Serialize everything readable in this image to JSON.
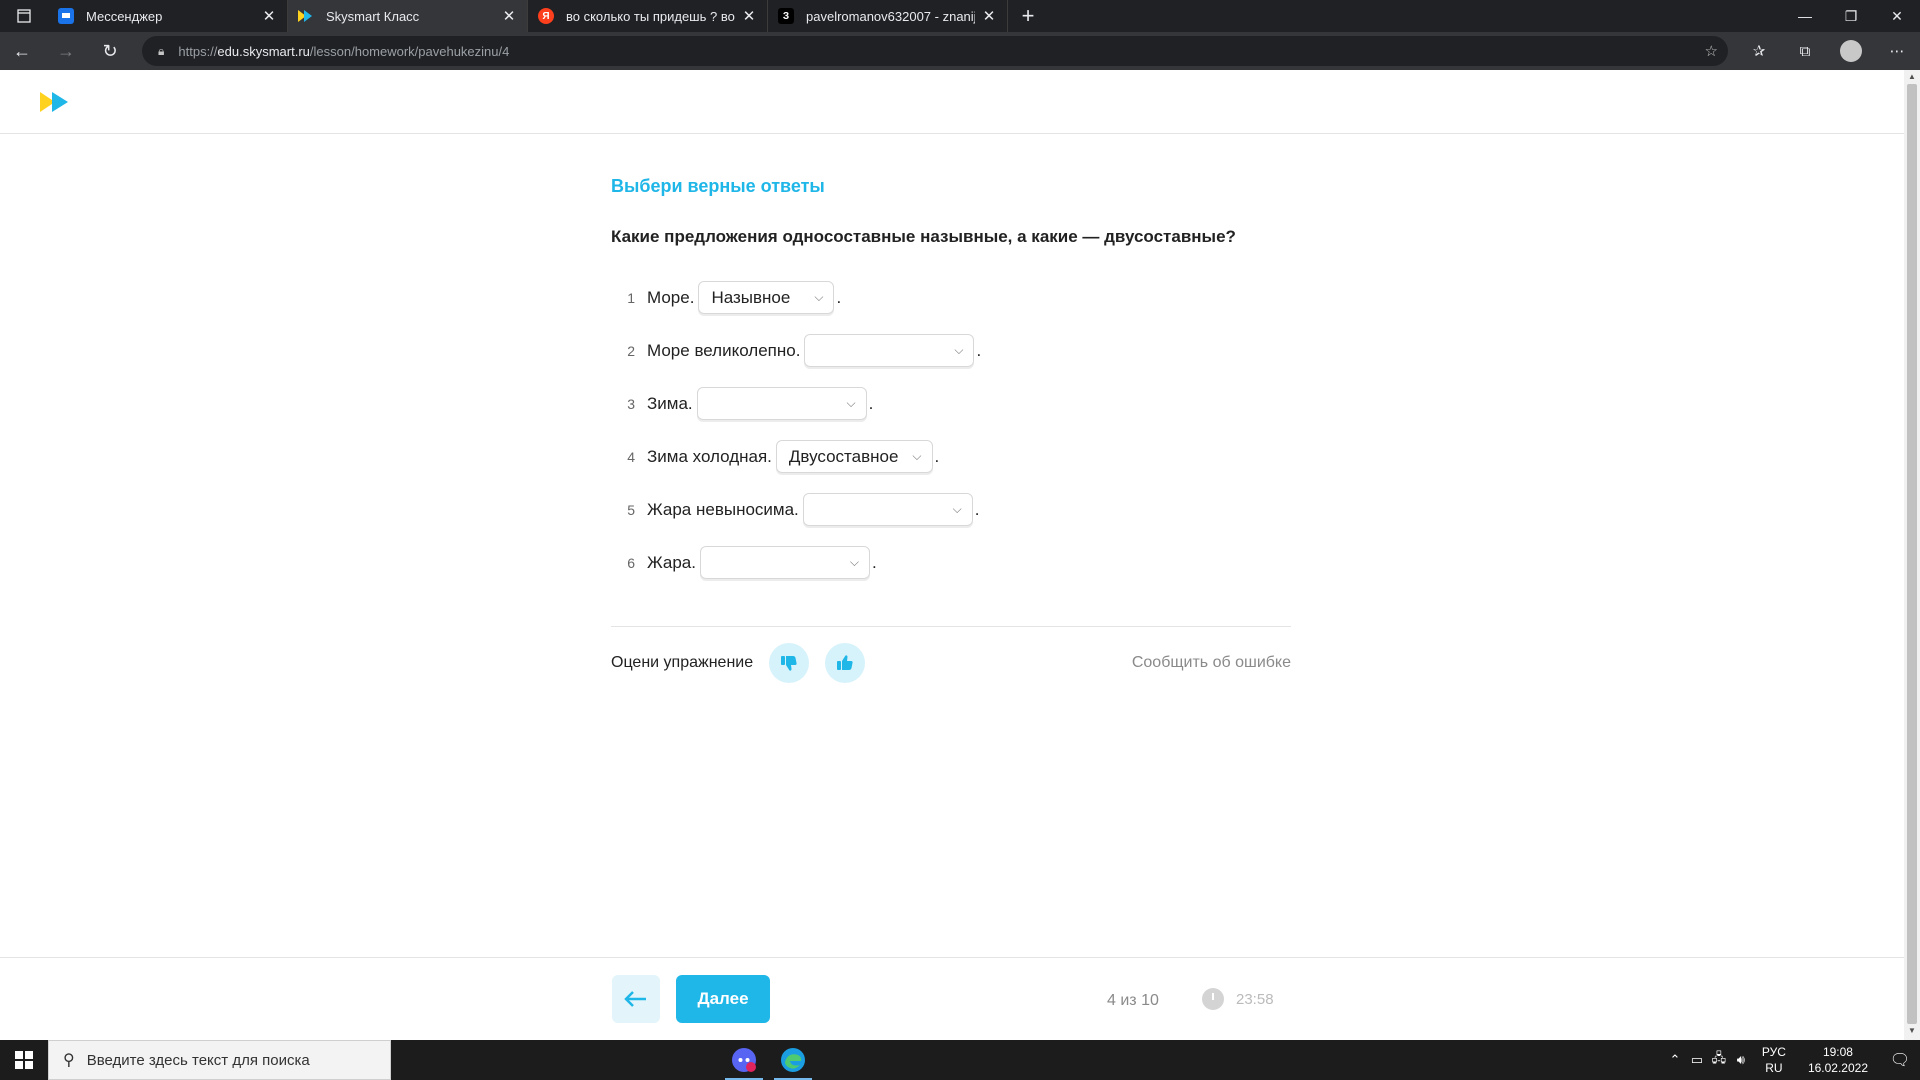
{
  "browser": {
    "tabs": [
      {
        "title": "Мессенджер",
        "icon": "messenger-icon",
        "color": "#1a73e8"
      },
      {
        "title": "Skysmart Класс",
        "icon": "skysmart-icon",
        "color": "#1fb6e8"
      },
      {
        "title": "во сколько ты придешь ? во вс",
        "icon": "yandex-icon",
        "color": "#fc3f1d"
      },
      {
        "title": "pavelromanov632007 - znanija.c",
        "icon": "znanija-icon",
        "color": "#000000"
      }
    ],
    "url_prefix": "https://",
    "url_domain": "edu.skysmart.ru",
    "url_path": "/lesson/homework/pavehukezinu/4"
  },
  "exercise": {
    "subtitle": "Выбери верные ответы",
    "question": "Какие предложения односоставные назывные, а какие — двусоставные?",
    "items": [
      {
        "num": "1",
        "text": "Море.",
        "answer": "Назывное"
      },
      {
        "num": "2",
        "text": "Море великолепно.",
        "answer": ""
      },
      {
        "num": "3",
        "text": "Зима.",
        "answer": ""
      },
      {
        "num": "4",
        "text": "Зима холодная.",
        "answer": "Двусоставное"
      },
      {
        "num": "5",
        "text": "Жара невыносима.",
        "answer": ""
      },
      {
        "num": "6",
        "text": "Жара.",
        "answer": ""
      }
    ],
    "rate_label": "Оцени упражнение",
    "report_label": "Сообщить об ошибке"
  },
  "footer": {
    "next_label": "Далее",
    "progress": "4 из 10",
    "timer": "23:58"
  },
  "taskbar": {
    "search_placeholder": "Введите здесь текст для поиска",
    "lang_top": "РУС",
    "lang_bottom": "RU",
    "time": "19:08",
    "date": "16.02.2022"
  },
  "colors": {
    "accent": "#1fb6e8",
    "accent_light": "#d6f2fb",
    "logo_yellow": "#ffd21f",
    "logo_blue": "#1fb6e8"
  }
}
